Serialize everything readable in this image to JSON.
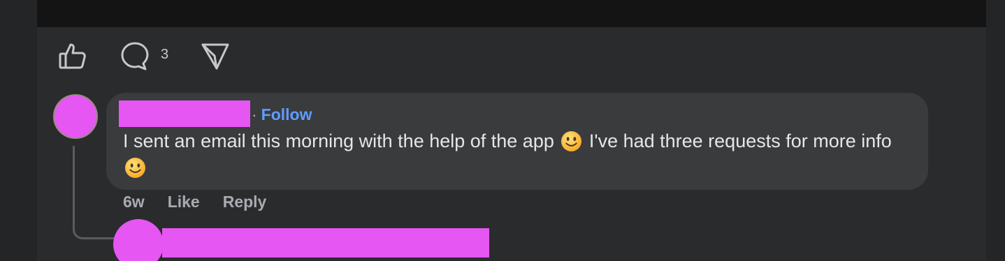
{
  "post_actions": {
    "like_icon": "thumbs-up-icon",
    "comment_icon": "comment-bubble-icon",
    "comment_count": "3",
    "share_icon": "send-icon"
  },
  "comment": {
    "author_redacted": true,
    "follow_separator": "·",
    "follow_label": "Follow",
    "text_part1": "I sent an email this morning with the help of the app",
    "text_part2": "I've had three requests for more info",
    "emoji": "slightly-smiling-face",
    "timestamp": "6w",
    "like_label": "Like",
    "reply_label": "Reply"
  },
  "reply": {
    "author_redacted": true
  },
  "colors": {
    "background": "#242527",
    "panel": "#2a2b2d",
    "bubble": "#3a3b3d",
    "link": "#5e9dff",
    "redaction": "#e556f3"
  }
}
